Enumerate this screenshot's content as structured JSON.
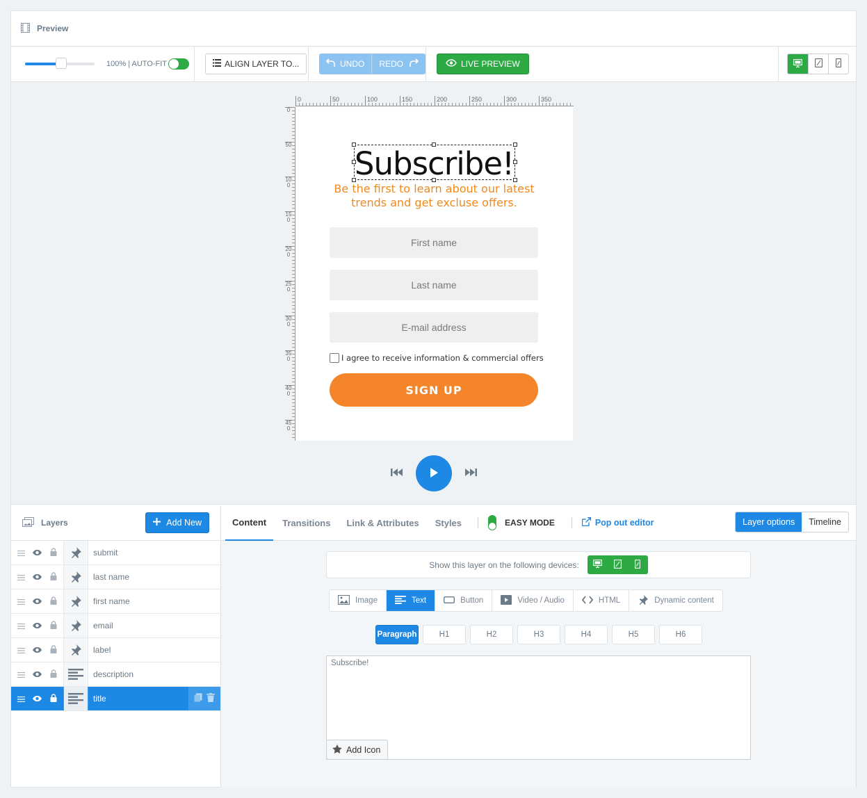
{
  "header": {
    "title": "Preview"
  },
  "toolbar": {
    "zoom_label": "100% | AUTO-FIT",
    "zoom_fraction": 0.51,
    "autofit_enabled": true,
    "align_label": "ALIGN LAYER TO...",
    "undo_label": "UNDO",
    "redo_label": "REDO",
    "live_preview_label": "LIVE PREVIEW",
    "device_selected": "desktop"
  },
  "ruler": {
    "h_labels": [
      "0",
      "50",
      "100",
      "150",
      "200",
      "250",
      "300",
      "350"
    ],
    "v_labels": [
      "0",
      "50",
      "100",
      "150",
      "200",
      "250",
      "300",
      "350",
      "400",
      "450"
    ]
  },
  "popup": {
    "title": "Subscribe!",
    "subtitle": "Be the first to learn about our latest trends and get excluse offers.",
    "first_name_placeholder": "First name",
    "last_name_placeholder": "Last name",
    "email_placeholder": "E-mail address",
    "agree_text": "I agree to receive information & commercial offers",
    "submit_label": "SIGN UP",
    "accent_color": "#f4852a"
  },
  "layers": {
    "title": "Layers",
    "add_new_label": "Add New",
    "items": [
      {
        "name": "submit",
        "type": "pin-icon",
        "active": false
      },
      {
        "name": "last name",
        "type": "pin-icon",
        "active": false
      },
      {
        "name": "first name",
        "type": "pin-icon",
        "active": false
      },
      {
        "name": "email",
        "type": "pin-icon",
        "active": false
      },
      {
        "name": "label",
        "type": "pin-icon",
        "active": false
      },
      {
        "name": "description",
        "type": "text-lines-icon",
        "active": false
      },
      {
        "name": "title",
        "type": "text-lines-icon",
        "active": true
      }
    ]
  },
  "options": {
    "tabs": [
      "Content",
      "Transitions",
      "Link & Attributes",
      "Styles"
    ],
    "active_tab": "Content",
    "easy_mode_label": "EASY MODE",
    "pop_out_label": "Pop out editor",
    "view_toggle": [
      "Layer options",
      "Timeline"
    ],
    "devices_label": "Show this layer on the following devices:",
    "content_types": [
      {
        "label": "Image",
        "icon": "image-icon"
      },
      {
        "label": "Text",
        "icon": "text-lines-icon",
        "active": true
      },
      {
        "label": "Button",
        "icon": "button-icon"
      },
      {
        "label": "Video / Audio",
        "icon": "video-icon"
      },
      {
        "label": "HTML",
        "icon": "code-icon"
      },
      {
        "label": "Dynamic content",
        "icon": "pin-icon"
      }
    ],
    "heading_levels": [
      "Paragraph",
      "H1",
      "H2",
      "H3",
      "H4",
      "H5",
      "H6"
    ],
    "text_value": "Subscribe!",
    "add_icon_label": "Add Icon"
  }
}
